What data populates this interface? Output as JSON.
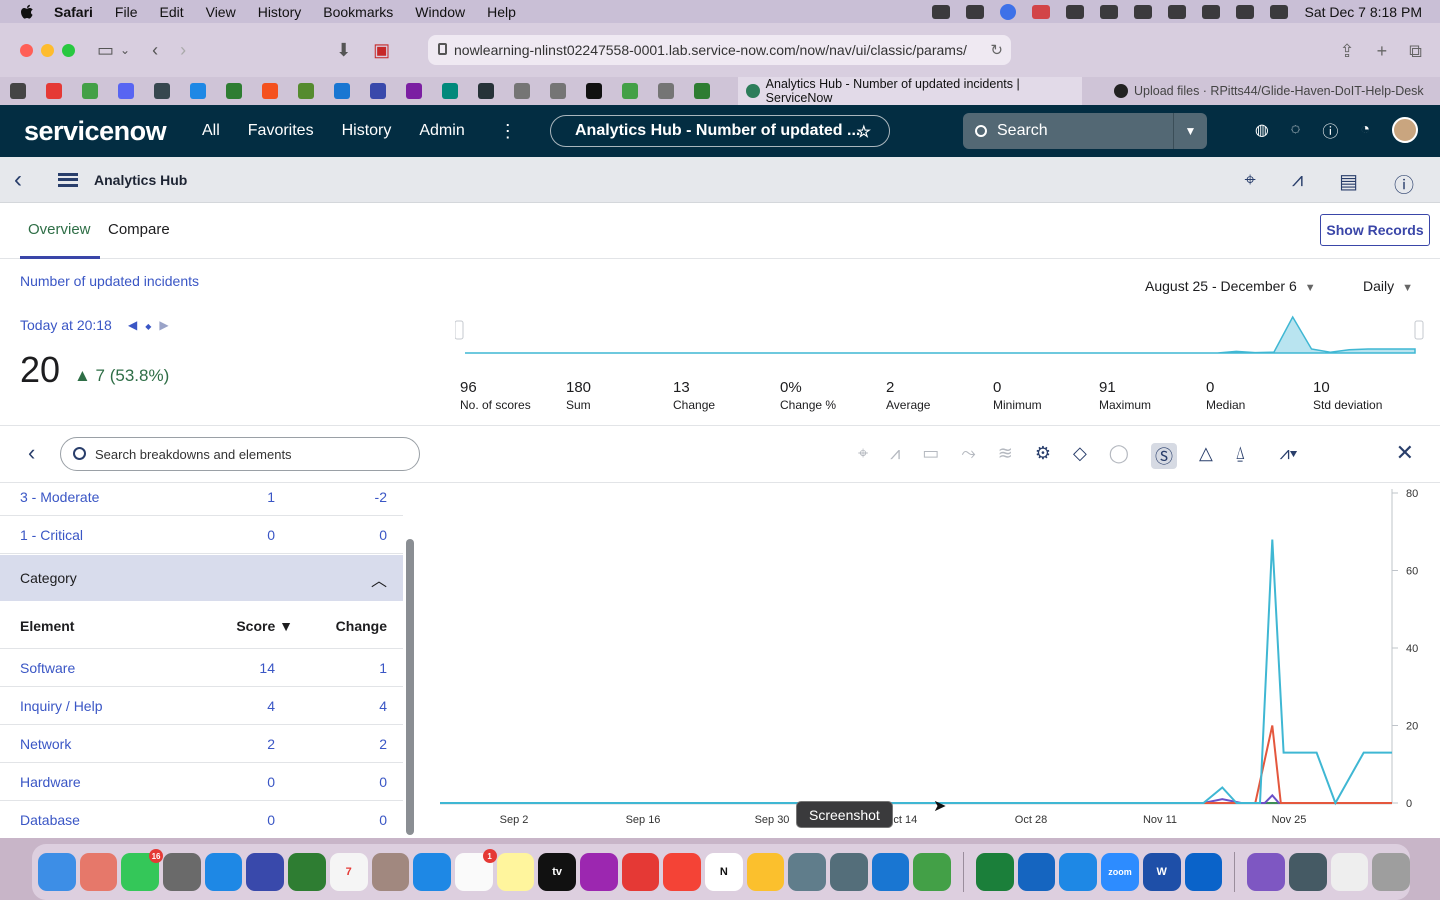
{
  "menubar": {
    "app": "Safari",
    "items": [
      "File",
      "Edit",
      "View",
      "History",
      "Bookmarks",
      "Window",
      "Help"
    ],
    "clock": "Sat Dec 7  8:18 PM"
  },
  "browser": {
    "url": "nowlearning-nlinst02247558-0001.lab.service-now.com/now/nav/ui/classic/params/",
    "active_tab": "Analytics Hub - Number of updated incidents | ServiceNow",
    "other_tab": "Upload files · RPitts44/Glide-Haven-DoIT-Help-Desk"
  },
  "sn_nav": {
    "logo": "servicenow",
    "menus": [
      "All",
      "Favorites",
      "History",
      "Admin"
    ],
    "title_pill": "Analytics Hub - Number of updated ...",
    "search_label": "Search"
  },
  "app_header": {
    "title": "Analytics Hub"
  },
  "tabs": {
    "overview": "Overview",
    "compare": "Compare",
    "show_records": "Show Records"
  },
  "indicator": {
    "name": "Number of updated incidents",
    "today": "Today at 20:18",
    "score": "20",
    "change": "▲ 7 (53.8%)",
    "date_range": "August 25 - December 6",
    "frequency": "Daily"
  },
  "stats": [
    {
      "value": "96",
      "label": "No. of scores"
    },
    {
      "value": "180",
      "label": "Sum"
    },
    {
      "value": "13",
      "label": "Change"
    },
    {
      "value": "0%",
      "label": "Change %"
    },
    {
      "value": "2",
      "label": "Average"
    },
    {
      "value": "0",
      "label": "Minimum"
    },
    {
      "value": "91",
      "label": "Maximum"
    },
    {
      "value": "0",
      "label": "Median"
    },
    {
      "value": "10",
      "label": "Std deviation"
    }
  ],
  "breakdown": {
    "search_placeholder": "Search breakdowns and elements",
    "priority_rows": [
      {
        "name": "3 - Moderate",
        "score": "1",
        "change": "-2"
      },
      {
        "name": "1 - Critical",
        "score": "0",
        "change": "0"
      }
    ],
    "category_header": "Category",
    "columns": {
      "element": "Element",
      "score": "Score ▼",
      "change": "Change"
    },
    "category_rows": [
      {
        "name": "Software",
        "score": "14",
        "change": "1"
      },
      {
        "name": "Inquiry / Help",
        "score": "4",
        "change": "4"
      },
      {
        "name": "Network",
        "score": "2",
        "change": "2"
      },
      {
        "name": "Hardware",
        "score": "0",
        "change": "0"
      },
      {
        "name": "Database",
        "score": "0",
        "change": "0"
      }
    ]
  },
  "chart_data": {
    "type": "line",
    "x_ticks": [
      "Sep 2",
      "Sep 16",
      "Sep 30",
      "Oct 14",
      "Oct 28",
      "Nov 11",
      "Nov 25"
    ],
    "y_ticks": [
      "80",
      "60",
      "40",
      "20",
      "0"
    ],
    "ylim": [
      0,
      80
    ],
    "x_days": [
      0,
      101
    ],
    "colors": {
      "teal": "#3fb7d3",
      "red": "#e4573d",
      "purple": "#6b4fc7",
      "green": "#3e8e55"
    },
    "series": [
      {
        "points": [
          [
            0,
            0
          ],
          [
            81,
            0
          ],
          [
            83,
            4
          ],
          [
            84.5,
            0
          ],
          [
            87,
            0
          ],
          [
            88.3,
            68
          ],
          [
            89.5,
            13
          ],
          [
            93,
            13
          ],
          [
            95,
            0
          ],
          [
            98,
            13
          ],
          [
            101,
            13
          ]
        ],
        "color": "teal"
      },
      {
        "points": [
          [
            0,
            0
          ],
          [
            86.5,
            0
          ],
          [
            88.3,
            20
          ],
          [
            89.2,
            0
          ],
          [
            101,
            0
          ]
        ],
        "color": "red"
      },
      {
        "points": [
          [
            0,
            0
          ],
          [
            81,
            0
          ],
          [
            83,
            1
          ],
          [
            85,
            0
          ],
          [
            87.5,
            0
          ],
          [
            88.3,
            2
          ],
          [
            89,
            0
          ],
          [
            101,
            0
          ]
        ],
        "color": "purple"
      },
      {
        "points": [
          [
            0,
            0
          ],
          [
            101,
            0
          ]
        ],
        "color": "green"
      }
    ]
  },
  "sparkline_data": {
    "type": "area",
    "ylim": [
      0,
      91
    ],
    "points": [
      [
        0,
        0
      ],
      [
        80,
        0
      ],
      [
        82,
        4
      ],
      [
        84,
        1
      ],
      [
        86,
        2
      ],
      [
        88,
        91
      ],
      [
        90,
        10
      ],
      [
        92,
        2
      ],
      [
        94,
        8
      ],
      [
        96,
        10
      ],
      [
        101,
        10
      ]
    ]
  },
  "tooltip": "Screenshot"
}
